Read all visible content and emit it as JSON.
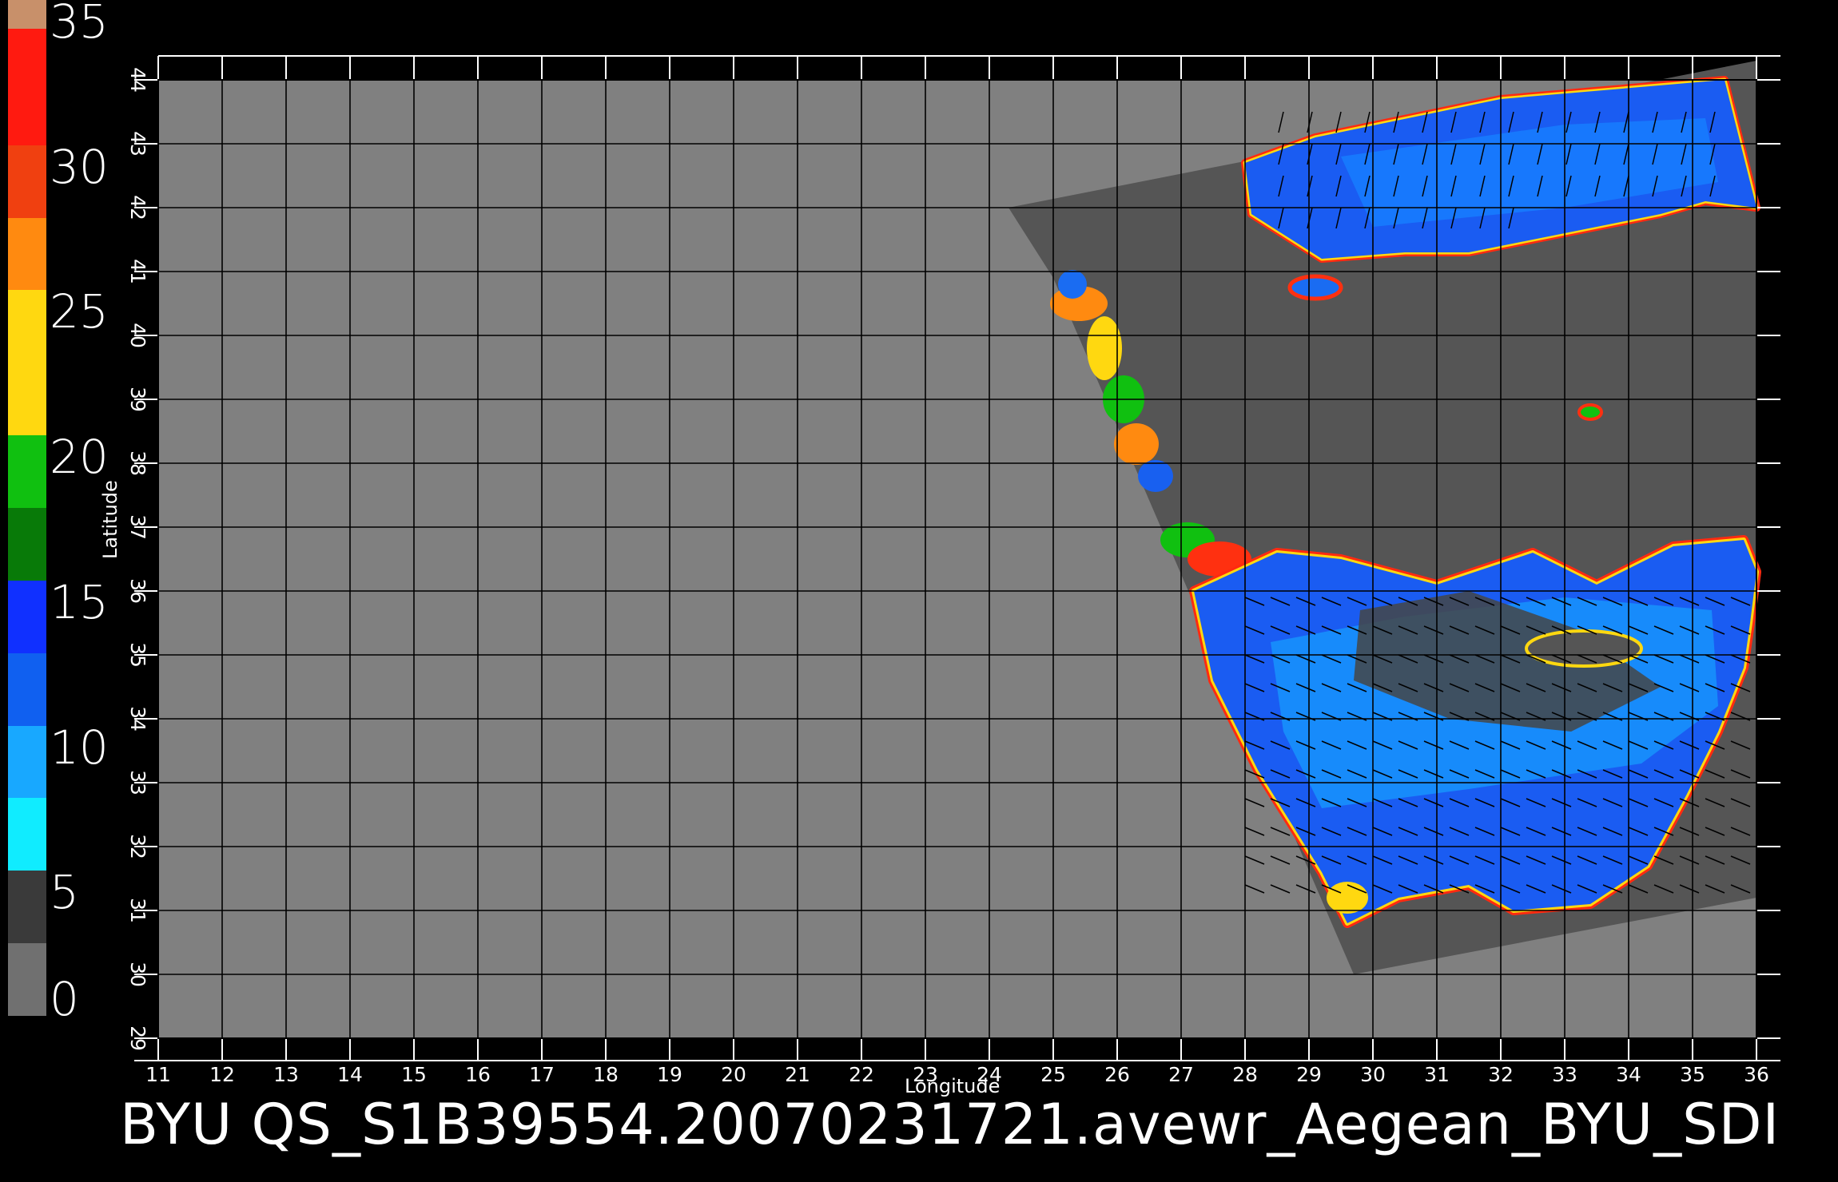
{
  "title": "BYU  QS_S1B39554.20070231721.avewr_Aegean_BYU_SDI",
  "colorbar": {
    "labels": [
      "35",
      "30",
      "25",
      "20",
      "15",
      "10",
      "5",
      "0"
    ],
    "segments": [
      {
        "from": 35,
        "to": 34,
        "color": "#c8906a"
      },
      {
        "from": 34,
        "to": 30,
        "color": "#ff1a10"
      },
      {
        "from": 30,
        "to": 27.5,
        "color": "#f04010"
      },
      {
        "from": 27.5,
        "to": 25,
        "color": "#ff8a10"
      },
      {
        "from": 25,
        "to": 20,
        "color": "#ffd810"
      },
      {
        "from": 20,
        "to": 17.5,
        "color": "#10c010"
      },
      {
        "from": 17.5,
        "to": 15,
        "color": "#087a08"
      },
      {
        "from": 15,
        "to": 12.5,
        "color": "#1030ff"
      },
      {
        "from": 12.5,
        "to": 10,
        "color": "#1060f0"
      },
      {
        "from": 10,
        "to": 7.5,
        "color": "#18a8ff"
      },
      {
        "from": 7.5,
        "to": 5,
        "color": "#10ecff"
      },
      {
        "from": 5,
        "to": 2.5,
        "color": "#3a3a3a"
      },
      {
        "from": 2.5,
        "to": 0,
        "color": "#707070"
      }
    ]
  },
  "axes": {
    "xlabel": "Longitude",
    "ylabel": "Latitude",
    "lon_ticks": [
      "11",
      "12",
      "13",
      "14",
      "15",
      "16",
      "17",
      "18",
      "19",
      "20",
      "21",
      "22",
      "23",
      "24",
      "25",
      "26",
      "27",
      "28",
      "29",
      "30",
      "31",
      "32",
      "33",
      "34",
      "35",
      "36"
    ],
    "lat_ticks": [
      "29",
      "30",
      "31",
      "32",
      "33",
      "34",
      "35",
      "36",
      "37",
      "38",
      "39",
      "40",
      "41",
      "42",
      "43",
      "44"
    ],
    "lon_range": [
      11,
      36
    ],
    "lat_range": [
      29,
      44
    ]
  },
  "colors": {
    "background": "#000000",
    "map_fill": "#808080",
    "swath_fill": "#555555",
    "grid": "#000000"
  }
}
